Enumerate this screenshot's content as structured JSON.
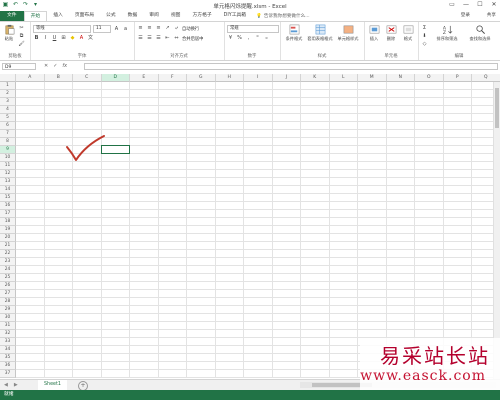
{
  "window": {
    "title": "单元格闪烁提醒.xlsm - Excel"
  },
  "ribbon_tabs": [
    "文件",
    "开始",
    "插入",
    "页面布局",
    "公式",
    "数据",
    "审阅",
    "视图",
    "方方格子",
    "DIY工具箱"
  ],
  "tell_me": "告诉我你想要做什么...",
  "login": "登录",
  "share": "共享",
  "clipboard": {
    "paste": "粘贴",
    "group": "剪贴板"
  },
  "font": {
    "name": "等线",
    "size": "11",
    "group": "字体"
  },
  "alignment": {
    "wrap": "自动换行",
    "merge": "合并后居中",
    "group": "对齐方式"
  },
  "number": {
    "format": "常规",
    "group": "数字"
  },
  "styles": {
    "conditional": "条件格式",
    "table": "套用表格格式",
    "cell": "单元格样式",
    "group": "样式"
  },
  "cells": {
    "insert": "插入",
    "delete": "删除",
    "format": "格式",
    "group": "单元格"
  },
  "editing": {
    "sort": "排序和筛选",
    "find": "查找和选择",
    "group": "编辑"
  },
  "name_box": "D9",
  "columns": [
    "A",
    "B",
    "C",
    "D",
    "E",
    "F",
    "G",
    "H",
    "I",
    "J",
    "K",
    "L",
    "M",
    "N",
    "O",
    "P",
    "Q"
  ],
  "rows": [
    "1",
    "2",
    "3",
    "4",
    "5",
    "6",
    "7",
    "8",
    "9",
    "10",
    "11",
    "12",
    "13",
    "14",
    "15",
    "16",
    "17",
    "18",
    "19",
    "20",
    "21",
    "22",
    "23",
    "24",
    "25",
    "26",
    "27",
    "28",
    "29",
    "30",
    "31",
    "32",
    "33",
    "34",
    "35",
    "36",
    "37"
  ],
  "sheet_tab": "Sheet1",
  "status": "就绪",
  "watermark": {
    "text": "易采站长站",
    "url": "www.easck.com"
  },
  "colors": {
    "accent": "#217346",
    "check_mark": "#c0392b"
  }
}
